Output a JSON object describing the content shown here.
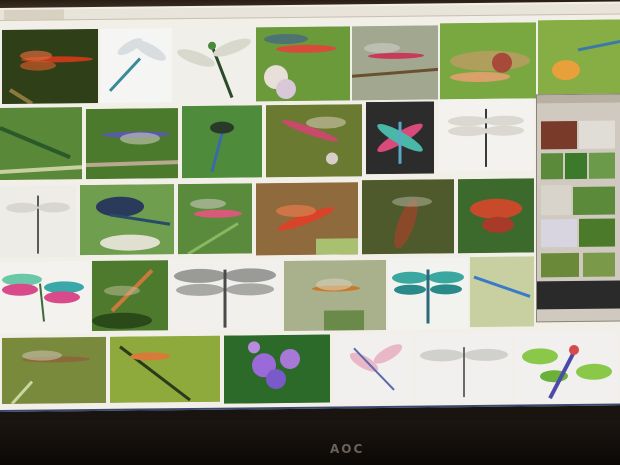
{
  "browser": {
    "tab_label": "",
    "address_text": ""
  },
  "brand": {
    "logo_text": "AOC"
  },
  "grid": {
    "row1": [
      "red-dragonfly",
      "blue-dragonfly-white",
      "green-dragonfly-white",
      "red-dragonfly-flower",
      "red-dragonfly-stick",
      "dragonfly-close",
      "orange-dragonfly"
    ],
    "row2": [
      "green-damselfly",
      "blue-dragonfly-twig",
      "blue-dragonfly-green",
      "red-dragonfly-branch",
      "colorful-dragonfly-dark",
      "grey-dragonfly-white"
    ],
    "row3": [
      "white-dragonfly",
      "dark-blue-dragonfly",
      "pink-dragonfly-grass",
      "red-dragonfly-brown",
      "brown-dragonfly",
      "red-dragonfly-leaves"
    ],
    "row4": [
      "pink-green-dragonfly-art",
      "orange-dragonfly-leaf",
      "grey-dragonfly-illustration",
      "orange-dragonfly-blur",
      "teal-dragonfly-art",
      "blue-dragonfly-sky"
    ],
    "row5": [
      "brown-dragonfly-grass",
      "orange-dragonfly-stem",
      "purple-flowers",
      "pink-dragonfly-art",
      "grey-dragonfly-art",
      "colorful-dragonfly-cartoon"
    ]
  },
  "colors": {
    "screen_bg": "#f2efe9",
    "taskbar": "#1d2844",
    "bezel": "#0b0806"
  }
}
